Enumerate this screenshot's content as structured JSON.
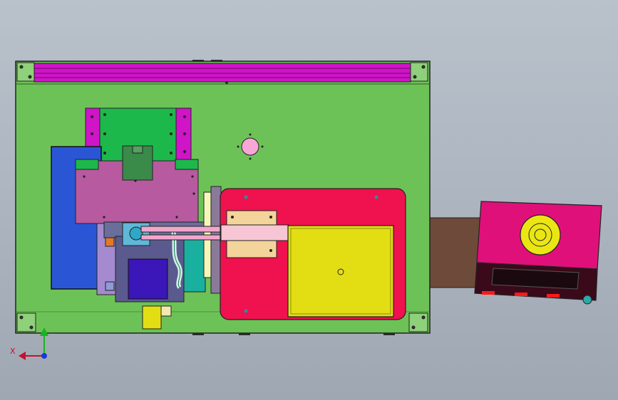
{
  "viewport": {
    "background": "#aeb6c1",
    "description_colors": {
      "base_plate": "#6dc257",
      "top_rail": "#d014c8",
      "blue_block": "#2a56d6",
      "pink_carrier": "#b85aa0",
      "green_top_block": "#1db84b",
      "red_platform": "#f0114f",
      "yellow_pad": "#e3de14",
      "control_box": "#e0107a"
    }
  },
  "triad": {
    "x_label": "X",
    "y_label": ""
  }
}
